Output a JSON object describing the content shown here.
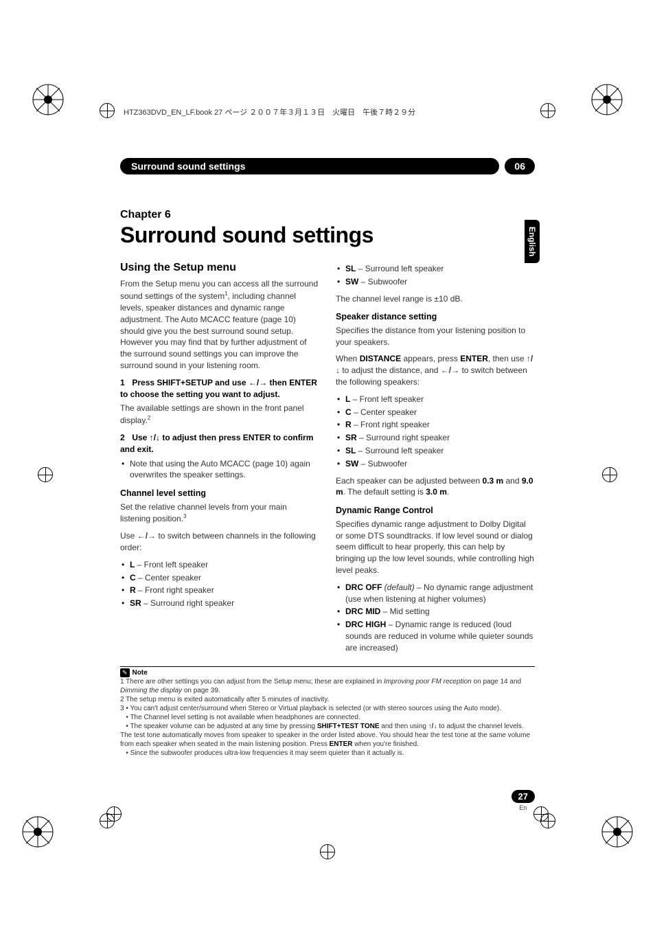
{
  "meta": {
    "print_line": "HTZ363DVD_EN_LF.book  27 ページ  ２００７年３月１３日　火曜日　午後７時２９分"
  },
  "header": {
    "title": "Surround sound settings",
    "chapter_num": "06"
  },
  "lang_tab": "English",
  "chapter": {
    "label": "Chapter 6",
    "title": "Surround sound settings"
  },
  "left": {
    "h2": "Using the Setup menu",
    "intro1_a": "From the Setup menu you can access all the surround sound settings of the system",
    "intro1_sup": "1",
    "intro1_b": ", including channel levels, speaker distances and dynamic range adjustment. The Auto MCACC feature (page 10) should give you the best surround sound setup. However you may find that by further adjustment of the surround sound settings you can improve the surround sound in your listening room.",
    "step1_num": "1",
    "step1_a": "Press SHIFT+SETUP and use ",
    "step1_arrows": "←/→",
    "step1_b": " then ENTER to choose the setting you want to adjust.",
    "step1_after_a": "The available settings are shown in the front panel display.",
    "step1_after_sup": "2",
    "step2_num": "2",
    "step2_a": "Use ",
    "step2_arrows": "↑/↓",
    "step2_b": " to adjust then press ENTER to confirm and exit.",
    "step2_bullet": "Note that using the Auto MCACC (page 10) again overwrites the speaker settings.",
    "h3_channel": "Channel level setting",
    "channel_intro_a": "Set the relative channel levels from your main listening position.",
    "channel_intro_sup": "3",
    "channel_use_a": "Use ",
    "channel_use_arr": "←/→",
    "channel_use_b": " to switch between channels in the following order:",
    "channel_list": [
      {
        "code": "L",
        "desc": " – Front left speaker"
      },
      {
        "code": "C",
        "desc": " – Center speaker"
      },
      {
        "code": "R",
        "desc": " – Front right speaker"
      },
      {
        "code": "SR",
        "desc": " – Surround right speaker"
      }
    ]
  },
  "right": {
    "top_list": [
      {
        "code": "SL",
        "desc": " – Surround left speaker"
      },
      {
        "code": "SW",
        "desc": " – Subwoofer"
      }
    ],
    "channel_range": "The channel level range is ±10 dB.",
    "h3_dist": "Speaker distance setting",
    "dist_intro": "Specifies the distance from your listening position to your speakers.",
    "dist_when_a": "When ",
    "dist_when_b": "DISTANCE",
    "dist_when_c": " appears, press ",
    "dist_when_d": "ENTER",
    "dist_when_e": ", then use ",
    "dist_when_arr1": "↑/↓",
    "dist_when_f": " to adjust the distance, and ",
    "dist_when_arr2": "←/→",
    "dist_when_g": " to switch between the following speakers:",
    "dist_list": [
      {
        "code": "L",
        "desc": " – Front left speaker"
      },
      {
        "code": "C",
        "desc": " – Center speaker"
      },
      {
        "code": "R",
        "desc": " – Front right speaker"
      },
      {
        "code": "SR",
        "desc": " – Surround right speaker"
      },
      {
        "code": "SL",
        "desc": " – Surround left speaker"
      },
      {
        "code": "SW",
        "desc": " – Subwoofer"
      }
    ],
    "dist_range_a": "Each speaker can be adjusted between ",
    "dist_range_b": "0.3 m",
    "dist_range_c": " and ",
    "dist_range_d": "9.0 m",
    "dist_range_e": ". The default setting is ",
    "dist_range_f": "3.0 m",
    "dist_range_g": ".",
    "h3_drc": "Dynamic Range Control",
    "drc_intro": "Specifies dynamic range adjustment to Dolby Digital or some DTS soundtracks. If low level sound or dialog seem difficult to hear properly, this can help by bringing up the low level sounds, while controlling high level peaks.",
    "drc_list": [
      {
        "code": "DRC OFF",
        "ital": " (default)",
        "desc": " – No dynamic range adjustment (use when listening at higher volumes)"
      },
      {
        "code": "DRC MID",
        "ital": "",
        "desc": " – Mid setting"
      },
      {
        "code": "DRC HIGH",
        "ital": "",
        "desc": " – Dynamic range is reduced (loud sounds are reduced in volume while quieter sounds are increased)"
      }
    ]
  },
  "notes": {
    "icon": "✎",
    "head": "Note",
    "n1_a": "1 There are other settings you can adjust from the Setup menu; these are explained in ",
    "n1_i1": "Improving poor FM reception",
    "n1_b": " on page 14 and ",
    "n1_i2": "Dimming the display",
    "n1_c": " on page 39.",
    "n2": "2 The setup menu is exited automatically after 5 minutes of inactivity.",
    "n3a": "3 • You can't adjust center/surround when Stereo or Virtual playback is selected (or with stereo sources using the Auto mode).",
    "n3b": "• The Channel level setting is not available when headphones are connected.",
    "n3c_a": "• The speaker volume can be adjusted at any time by pressing ",
    "n3c_b": "SHIFT+TEST TONE",
    "n3c_c": " and then using ",
    "n3c_arr": "↑/↓",
    "n3c_d": " to adjust the channel levels. The test tone automatically moves from speaker to speaker in the order listed above. You should hear the test tone at the same volume from each speaker when seated in the main listening position. Press ",
    "n3c_e": "ENTER",
    "n3c_f": " when you're finished.",
    "n3d": "• Since the subwoofer produces ultra-low frequencies it may seem quieter than it actually is."
  },
  "page_num": {
    "num": "27",
    "lang": "En"
  }
}
